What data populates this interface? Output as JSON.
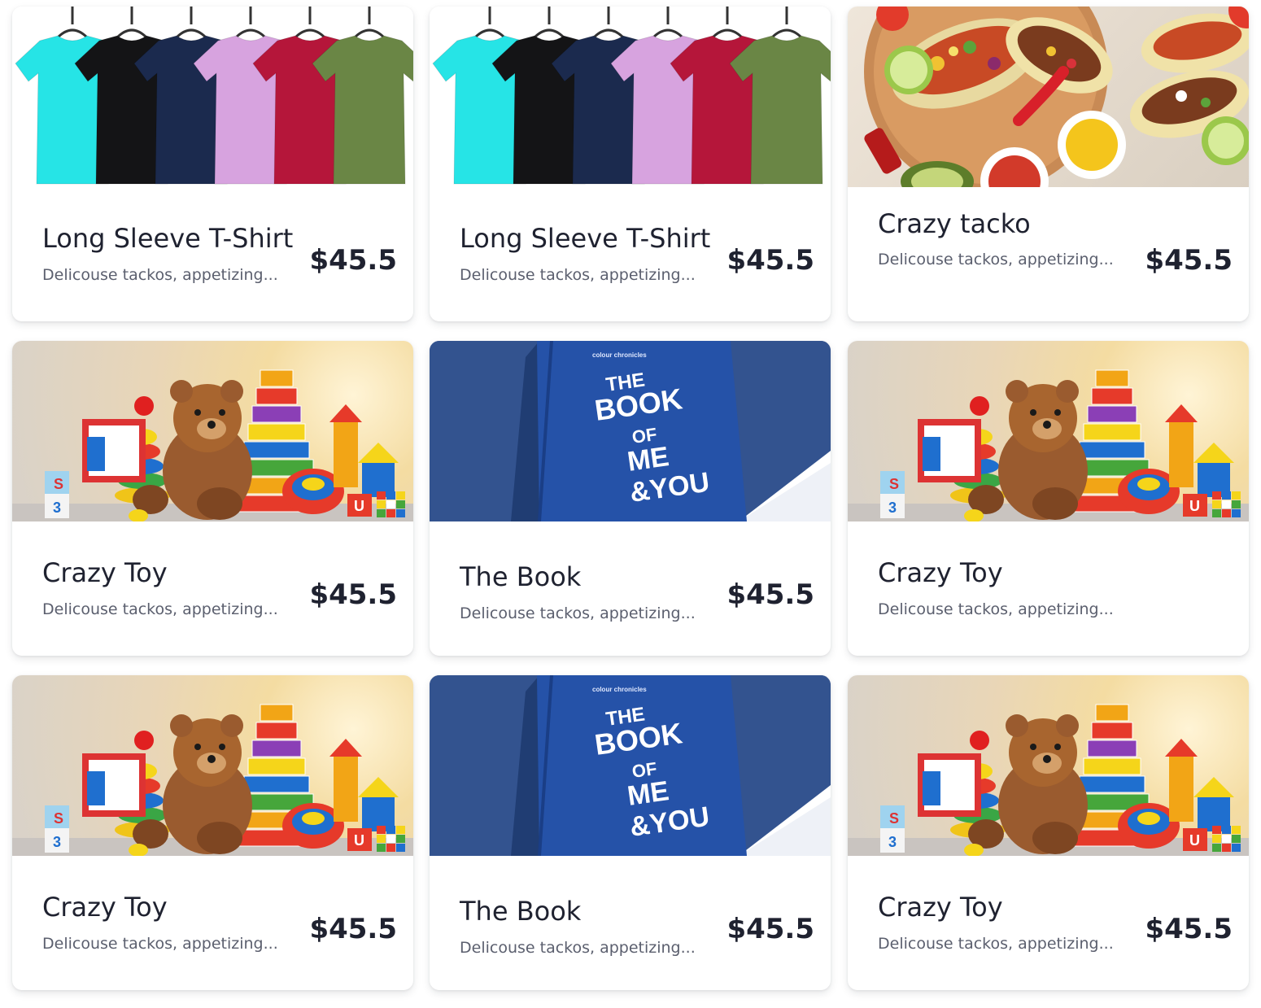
{
  "products": [
    {
      "title": "Long Sleeve T-Shirt",
      "description": "Delicouse tackos, appetizing...",
      "price": "$45.5",
      "image": "t-shirts-image"
    },
    {
      "title": "Long Sleeve T-Shirt",
      "description": "Delicouse tackos, appetizing...",
      "price": "$45.5",
      "image": "t-shirts-image"
    },
    {
      "title": "Crazy tacko",
      "description": "Delicouse tackos, appetizing...",
      "price": "$45.5",
      "image": "tacos-image"
    },
    {
      "title": "Crazy Toy",
      "description": "Delicouse tackos, appetizing...",
      "price": "$45.5",
      "image": "toys-image"
    },
    {
      "title": "The Book",
      "description": "Delicouse tackos, appetizing...",
      "price": "$45.5",
      "image": "book-image"
    },
    {
      "title": "Crazy Toy",
      "description": "Delicouse tackos, appetizing...",
      "price": "",
      "image": "toys-image"
    },
    {
      "title": "Crazy Toy",
      "description": "Delicouse tackos, appetizing...",
      "price": "$45.5",
      "image": "toys-image"
    },
    {
      "title": "The Book",
      "description": "Delicouse tackos, appetizing...",
      "price": "$45.5",
      "image": "book-image"
    },
    {
      "title": "Crazy Toy",
      "description": "Delicouse tackos, appetizing...",
      "price": "$45.5",
      "image": "toys-image"
    }
  ],
  "book_cover": {
    "brand": "colour chronicles",
    "lines": [
      "THE",
      "BOOK",
      "OF",
      "ME",
      "&YOU"
    ]
  },
  "toy_blocks": {
    "letter_s": "S",
    "digit_3": "3",
    "letter_u": "U"
  },
  "colors": {
    "shirt_cyan": "#26e4e6",
    "shirt_black": "#141416",
    "shirt_navy": "#1b2a4e",
    "shirt_lilac": "#d7a3df",
    "shirt_red": "#b5163a",
    "shirt_olive": "#6a8645",
    "book_blue": "#2552a8",
    "book_bg": "#33538f"
  }
}
